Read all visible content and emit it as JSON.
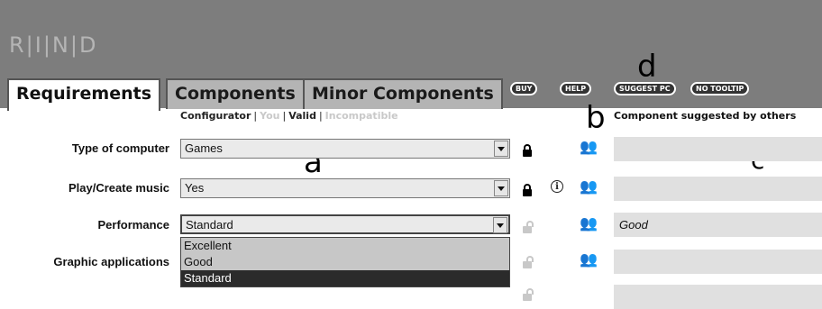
{
  "brand": "R|I|N|D",
  "tabs": [
    {
      "label": "Requirements",
      "active": true
    },
    {
      "label": "Components",
      "active": false
    },
    {
      "label": "Minor Components",
      "active": false
    }
  ],
  "buttons": {
    "buy": "BUY",
    "help": "HELP",
    "suggest_pc": "SUGGEST PC",
    "no_tooltip": "NO TOOLTIP"
  },
  "markers": {
    "a": "a",
    "b": "b",
    "c": "c",
    "d": "d"
  },
  "subnav": {
    "configurator": "Configurator",
    "you": "You",
    "valid": "Valid",
    "incompatible": "Incompatible",
    "sep": "|"
  },
  "column_header": "Component suggested by others",
  "rows": [
    {
      "label": "Type of computer",
      "value": "Games",
      "locked": true,
      "info": false,
      "suggestion": ""
    },
    {
      "label": "Play/Create music",
      "value": "Yes",
      "locked": true,
      "info": true,
      "suggestion": ""
    },
    {
      "label": "Performance",
      "value": "Standard",
      "locked": false,
      "info": false,
      "suggestion": "Good"
    },
    {
      "label": "Graphic applications",
      "value": "",
      "locked": false,
      "info": false,
      "suggestion": ""
    }
  ],
  "dropdown_options": [
    "Excellent",
    "Good",
    "Standard"
  ],
  "dropdown_selected": "Standard",
  "icons": {
    "lock": "lock-icon",
    "info": "info-icon",
    "people": "people-icon"
  },
  "colors": {
    "topbar": "#7d7d7d",
    "tab_inactive": "#b4b4b4",
    "field": "#e0e0e0"
  }
}
